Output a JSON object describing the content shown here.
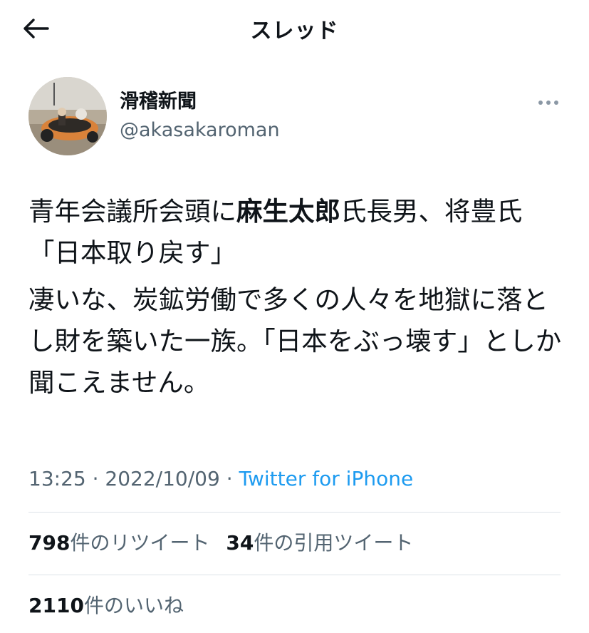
{
  "header": {
    "title": "スレッド"
  },
  "author": {
    "display_name": "滑稽新聞",
    "handle": "@akasakaroman"
  },
  "tweet": {
    "p1_a": "青年会議所会頭に",
    "p1_bold": "麻生太郎",
    "p1_b": "氏長男、将豊氏「日本取り戻す」",
    "p2": "凄いな、炭鉱労働で多くの人々を地獄に落とし財を築いた一族。「日本をぶっ壊す」としか聞こえません。"
  },
  "meta": {
    "time": "13:25",
    "date": "2022/10/09",
    "separator": "·",
    "source": "Twitter for iPhone"
  },
  "stats": {
    "retweets_count": "798",
    "retweets_label": "件のリツイート",
    "quotes_count": "34",
    "quotes_label": "件の引用ツイート",
    "likes_count": "2110",
    "likes_label": "件のいいね"
  },
  "colors": {
    "text": "#0f1419",
    "secondary": "#536471",
    "link": "#1d9bf0",
    "divider": "#dde3e8"
  },
  "icons": {
    "back": "arrow-left-icon",
    "more": "more-dots-icon"
  }
}
